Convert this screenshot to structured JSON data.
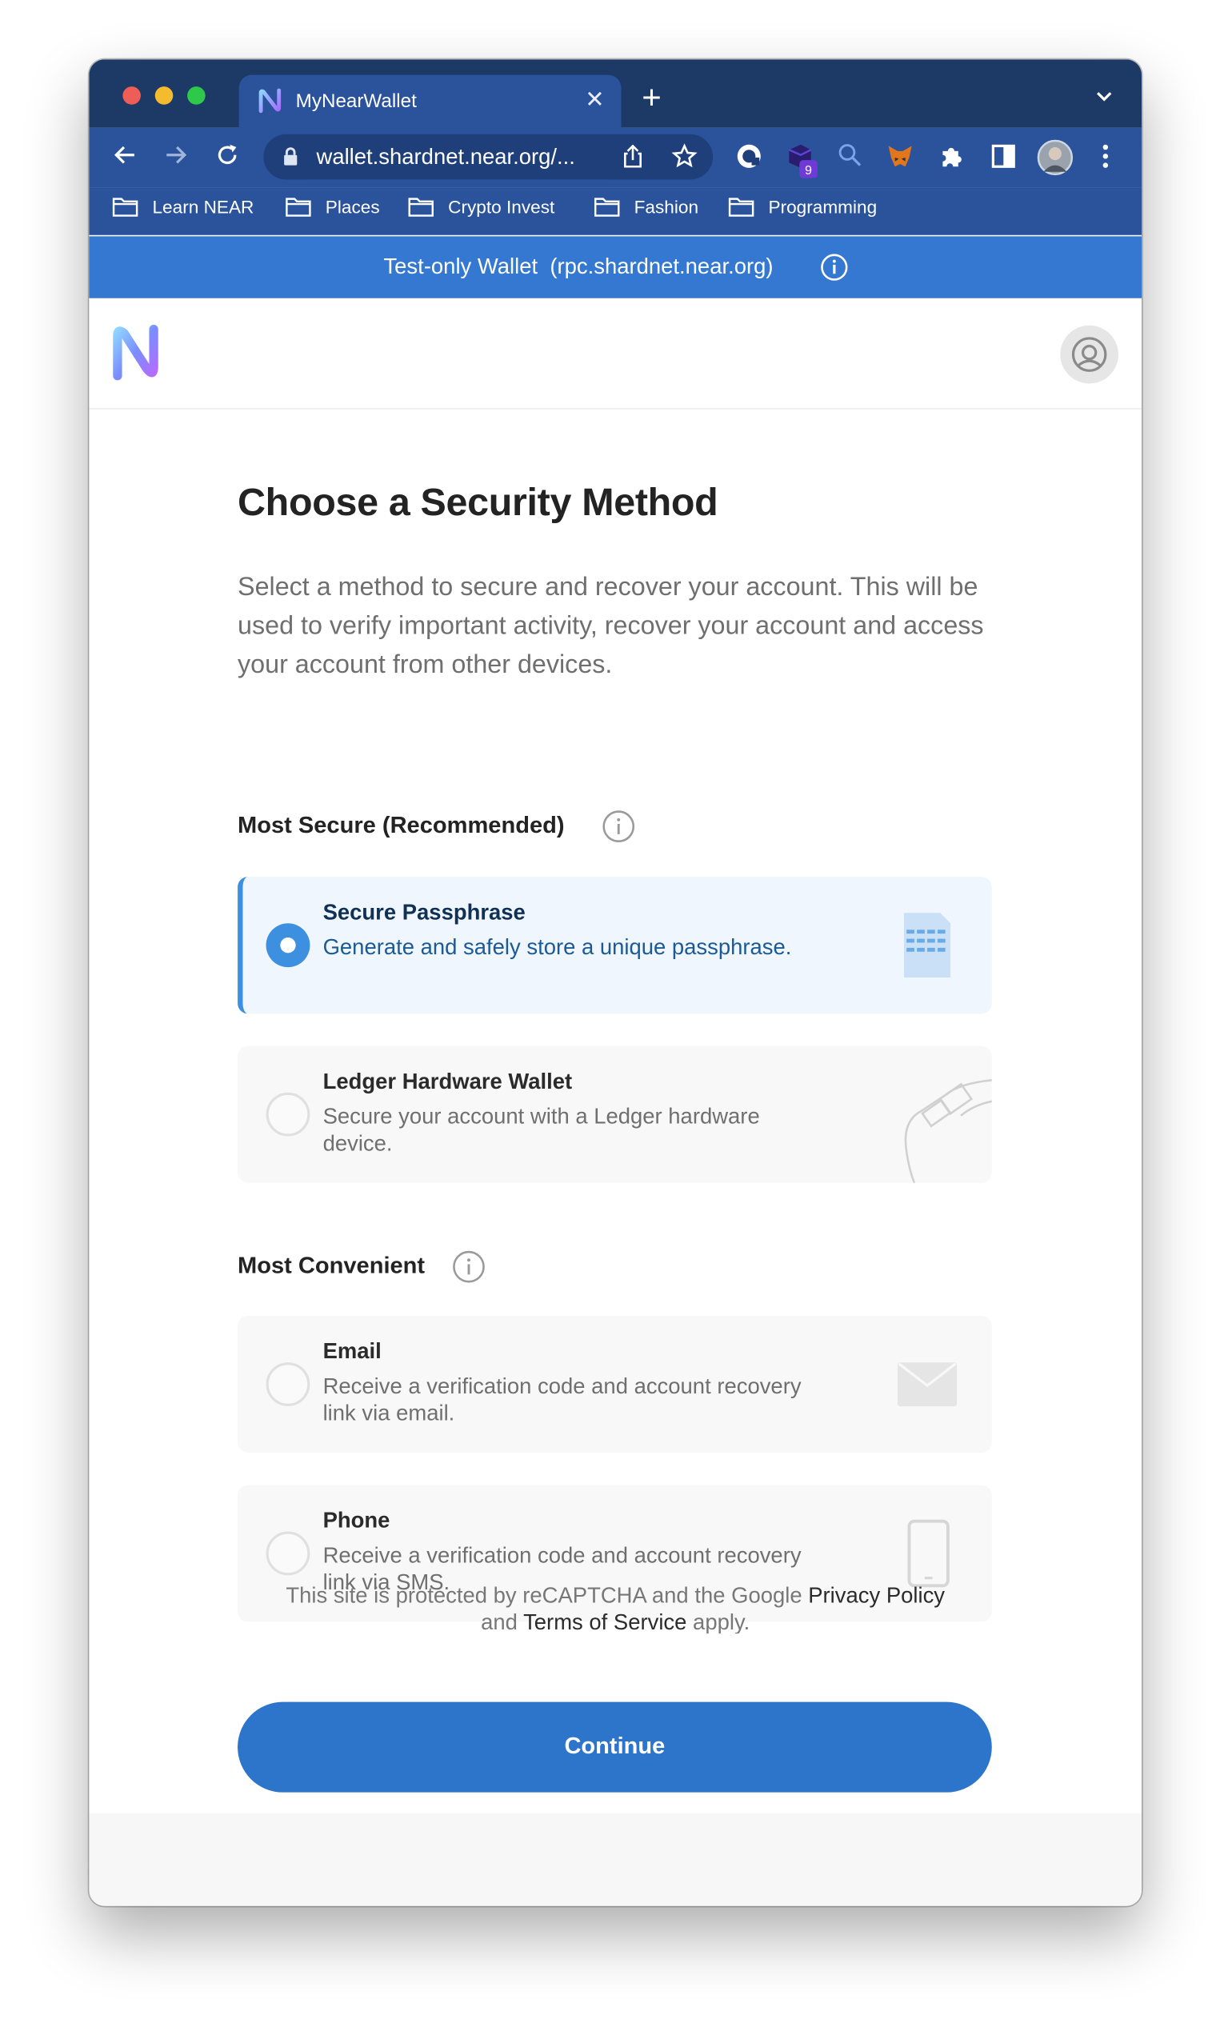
{
  "browser": {
    "tab_title": "MyNearWallet",
    "tab_close_icon": "close-icon",
    "url": "wallet.shardnet.near.org/...",
    "extension_badge": "9",
    "bookmarks": [
      "Learn NEAR",
      "Places",
      "Crypto Invest",
      "Fashion",
      "Programming"
    ],
    "accent": "#2a539c",
    "titlebar_color": "#1d3a66"
  },
  "banner": {
    "text": "Test-only Wallet  (rpc.shardnet.near.org)",
    "color": "#3478d2"
  },
  "page": {
    "title": "Choose a Security Method",
    "intro": "Select a method to secure and recover your account. This will be used to verify important activity, recover your account and access your account from other devices.",
    "sections": {
      "secure": {
        "label": "Most Secure (Recommended)",
        "options": [
          {
            "title": "Secure Passphrase",
            "desc": "Generate and safely store a unique passphrase.",
            "selected": true,
            "icon": "passphrase-document-icon"
          },
          {
            "title": "Ledger Hardware Wallet",
            "desc": "Secure your account with a Ledger hardware device.",
            "selected": false,
            "icon": "ledger-usb-icon"
          }
        ]
      },
      "convenient": {
        "label": "Most Convenient",
        "options": [
          {
            "title": "Email",
            "desc": "Receive a verification code and account recovery link via email.",
            "selected": false,
            "icon": "envelope-icon"
          },
          {
            "title": "Phone",
            "desc": "Receive a verification code and account recovery link via SMS.",
            "selected": false,
            "icon": "phone-icon"
          }
        ]
      }
    },
    "continue_label": "Continue",
    "captcha": {
      "part1": "This site is protected by reCAPTCHA and the Google ",
      "privacy": "Privacy Policy",
      "part2": " and ",
      "terms": "Terms of Service",
      "part3": " apply."
    },
    "accent": "#2d74cb"
  }
}
